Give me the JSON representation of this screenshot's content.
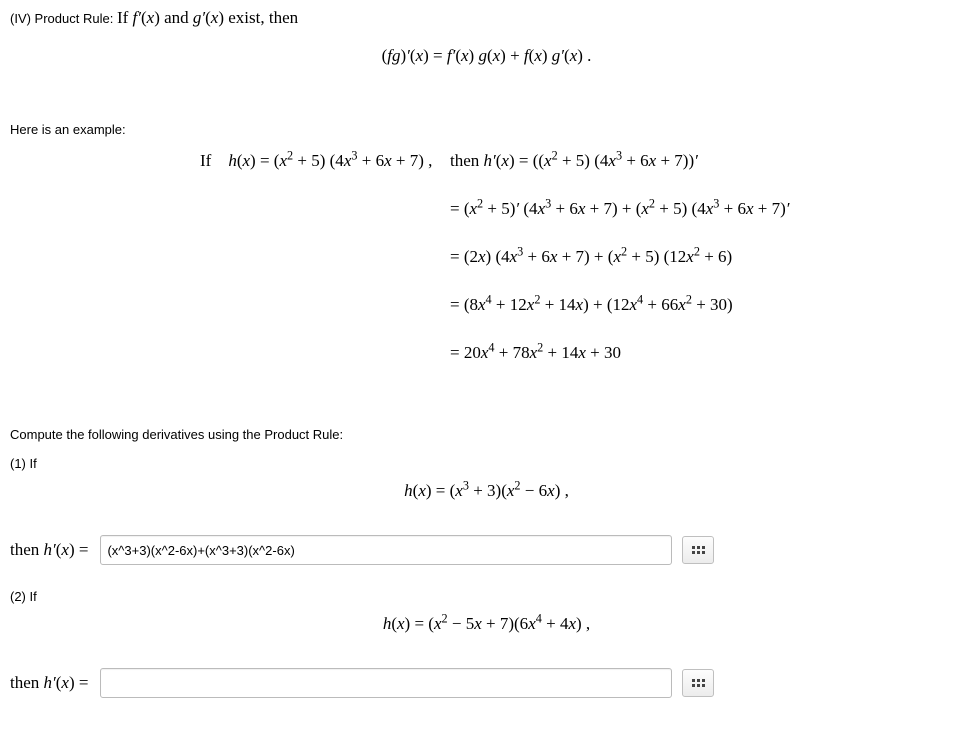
{
  "heading": {
    "roman": "(IV) Product Rule: ",
    "condition_html": "If <i>f&prime;</i>(<i>x</i>) and <i>g&prime;</i>(<i>x</i>) exist, then"
  },
  "rule_formula_html": "(<i>fg</i>)<i>&prime;</i>(<i>x</i>) = <i>f&prime;</i>(<i>x</i>) <i>g</i>(<i>x</i>) + <i>f</i>(<i>x</i>) <i>g&prime;</i>(<i>x</i>) .",
  "example_intro": "Here is an example:",
  "example": {
    "if_label": "If",
    "hx_def_html": "<i>h</i>(<i>x</i>) = (<i>x</i><sup>2</sup> + 5) (4<i>x</i><sup>3</sup> + 6<i>x</i> + 7) ,",
    "then_html": "then <i>h&prime;</i>(<i>x</i>) = ((<i>x</i><sup>2</sup> + 5) (4<i>x</i><sup>3</sup> + 6<i>x</i> + 7))<i>&prime;</i>",
    "step2_html": "= (<i>x</i><sup>2</sup> + 5)<i>&prime;</i> (4<i>x</i><sup>3</sup> + 6<i>x</i> + 7) + (<i>x</i><sup>2</sup> + 5) (4<i>x</i><sup>3</sup> + 6<i>x</i> + 7)<i>&prime;</i>",
    "step3_html": "= (2<i>x</i>) (4<i>x</i><sup>3</sup> + 6<i>x</i> + 7) + (<i>x</i><sup>2</sup> + 5) (12<i>x</i><sup>2</sup> + 6)",
    "step4_html": "= (8<i>x</i><sup>4</sup> + 12<i>x</i><sup>2</sup> + 14<i>x</i>) + (12<i>x</i><sup>4</sup> + 66<i>x</i><sup>2</sup> + 30)",
    "step5_html": "= 20<i>x</i><sup>4</sup> + 78<i>x</i><sup>2</sup> + 14<i>x</i> + 30"
  },
  "prompt": "Compute the following derivatives using the Product Rule:",
  "questions": [
    {
      "num_label": "(1) If",
      "eq_html": "<i>h</i>(<i>x</i>) = (<i>x</i><sup>3</sup> + 3)(<i>x</i><sup>2</sup> &minus; 6<i>x</i>) ,",
      "answer_label_html": "then <i>h&prime;</i>(<i>x</i>) = ",
      "answer_value": "(x^3+3)(x^2-6x)+(x^3+3)(x^2-6x)"
    },
    {
      "num_label": "(2) If",
      "eq_html": "<i>h</i>(<i>x</i>) = (<i>x</i><sup>2</sup> &minus; 5<i>x</i> + 7)(6<i>x</i><sup>4</sup> + 4<i>x</i>) ,",
      "answer_label_html": "then <i>h&prime;</i>(<i>x</i>) = ",
      "answer_value": ""
    }
  ]
}
